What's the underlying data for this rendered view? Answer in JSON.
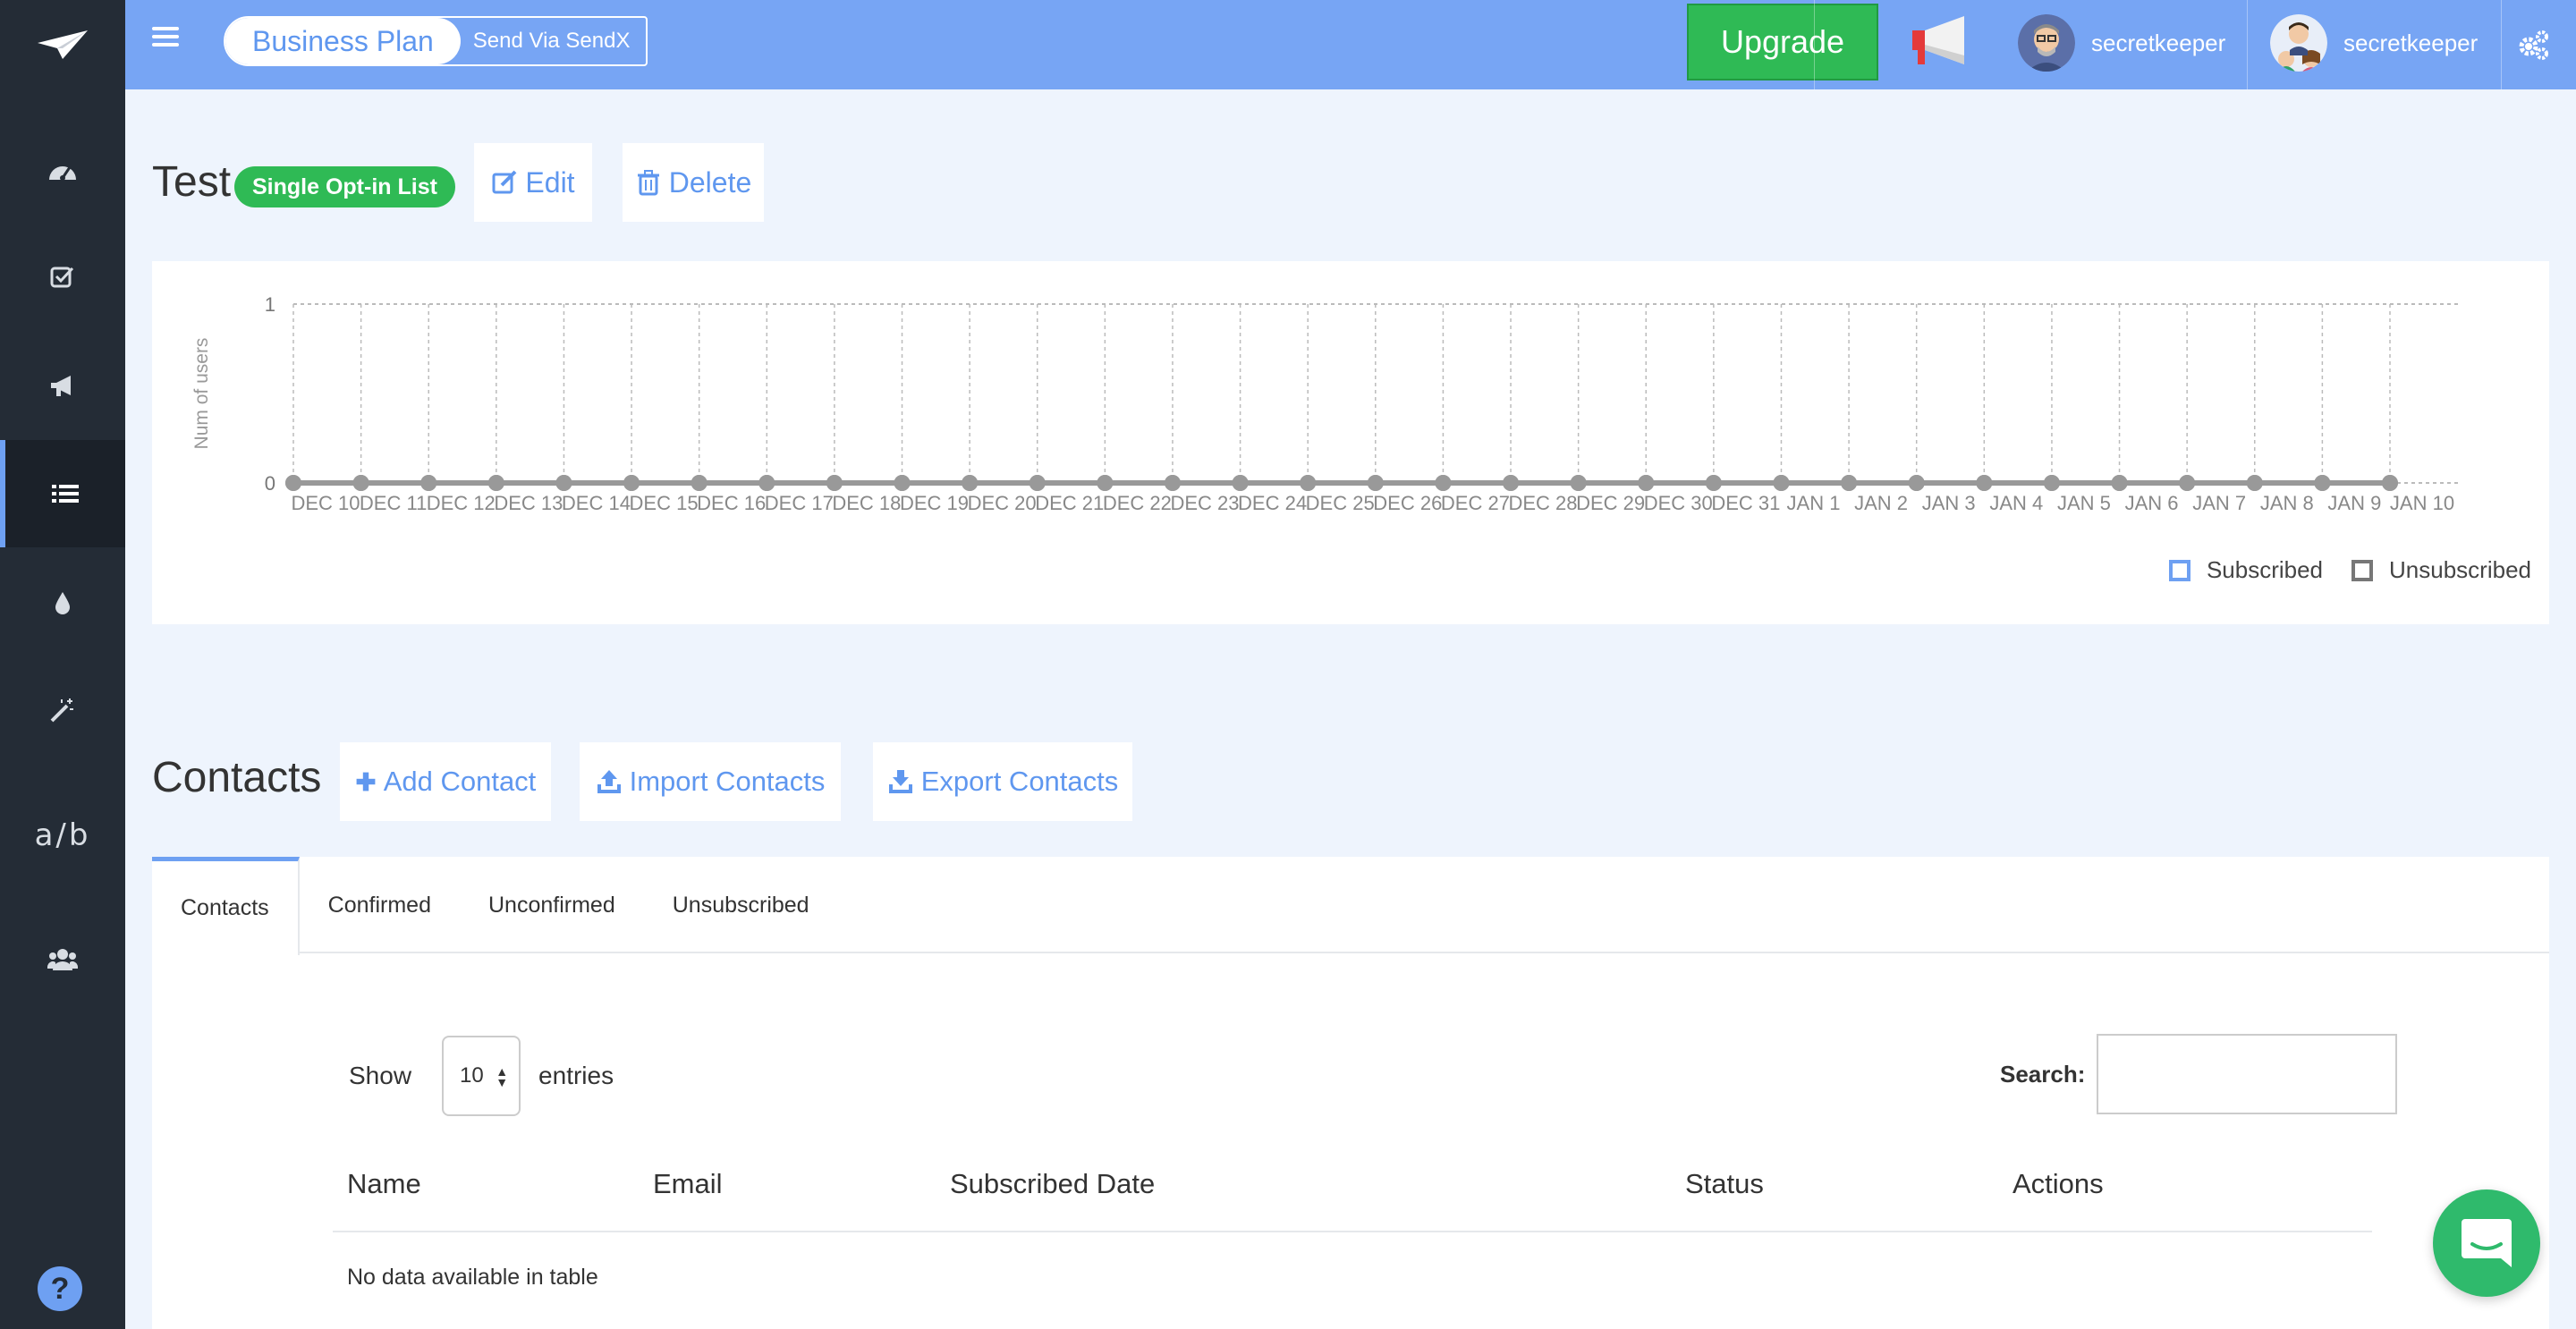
{
  "topbar": {
    "plan_label": "Business Plan",
    "plan_sub": "Send Via SendX",
    "upgrade_label": "Upgrade",
    "users": [
      {
        "name": "secretkeeper"
      },
      {
        "name": "secretkeeper"
      }
    ]
  },
  "sidebar": {
    "items": [
      {
        "icon": "dashboard-icon"
      },
      {
        "icon": "checkbox-icon"
      },
      {
        "icon": "megaphone-icon"
      },
      {
        "icon": "list-icon",
        "active": true
      },
      {
        "icon": "drop-icon"
      },
      {
        "icon": "magic-wand-icon"
      },
      {
        "label": "a/b"
      },
      {
        "icon": "users-icon"
      }
    ],
    "help_label": "?"
  },
  "list": {
    "title": "Test",
    "badge": "Single Opt-in List",
    "edit_label": "Edit",
    "delete_label": "Delete"
  },
  "colors": {
    "accent": "#6ea0f2",
    "topbar": "#77a5f4",
    "sidebar": "#242c36",
    "green": "#2fba55"
  },
  "chart_data": {
    "type": "line",
    "ylabel": "Num of users",
    "ylim": [
      0,
      1
    ],
    "yticks": [
      "0",
      "1"
    ],
    "x": [
      "DEC 10",
      "DEC 11",
      "DEC 12",
      "DEC 13",
      "DEC 14",
      "DEC 15",
      "DEC 16",
      "DEC 17",
      "DEC 18",
      "DEC 19",
      "DEC 20",
      "DEC 21",
      "DEC 22",
      "DEC 23",
      "DEC 24",
      "DEC 25",
      "DEC 26",
      "DEC 27",
      "DEC 28",
      "DEC 29",
      "DEC 30",
      "DEC 31",
      "JAN 1",
      "JAN 2",
      "JAN 3",
      "JAN 4",
      "JAN 5",
      "JAN 6",
      "JAN 7",
      "JAN 8",
      "JAN 9",
      "JAN 10"
    ],
    "series": [
      {
        "name": "Subscribed",
        "color": "#6ea0f2",
        "values": [
          0,
          0,
          0,
          0,
          0,
          0,
          0,
          0,
          0,
          0,
          0,
          0,
          0,
          0,
          0,
          0,
          0,
          0,
          0,
          0,
          0,
          0,
          0,
          0,
          0,
          0,
          0,
          0,
          0,
          0,
          0,
          0
        ]
      },
      {
        "name": "Unsubscribed",
        "color": "#999999",
        "values": [
          0,
          0,
          0,
          0,
          0,
          0,
          0,
          0,
          0,
          0,
          0,
          0,
          0,
          0,
          0,
          0,
          0,
          0,
          0,
          0,
          0,
          0,
          0,
          0,
          0,
          0,
          0,
          0,
          0,
          0,
          0,
          0
        ]
      }
    ],
    "grid": true,
    "legend": "bottom-right"
  },
  "contacts": {
    "title": "Contacts",
    "add_label": "Add Contact",
    "import_label": "Import Contacts",
    "export_label": "Export Contacts",
    "tabs": [
      {
        "label": "Contacts",
        "active": true
      },
      {
        "label": "Confirmed"
      },
      {
        "label": "Unconfirmed"
      },
      {
        "label": "Unsubscribed"
      }
    ],
    "show_label": "Show",
    "entries_value": "10",
    "entries_label": "entries",
    "search_label": "Search:",
    "search_value": "",
    "columns": [
      "Name",
      "Email",
      "Subscribed Date",
      "Status",
      "Actions"
    ],
    "empty_text": "No data available in table"
  }
}
